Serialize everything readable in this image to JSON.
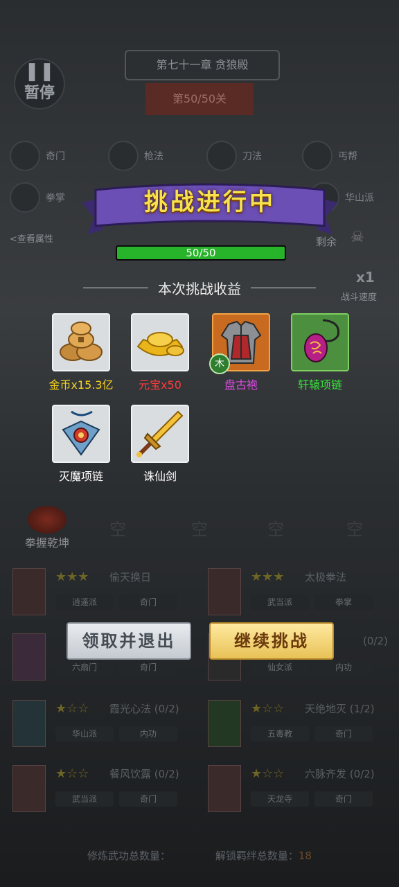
{
  "background": {
    "pause": {
      "icon": "pause-icon",
      "label": "暂停"
    },
    "chapter_title": "第七十一章 贪狼殿",
    "stage_label": "第50/50关",
    "skills_row1": [
      {
        "name": "奇门",
        "icon": "skill-icon"
      },
      {
        "name": "枪法",
        "icon": "skill-icon"
      },
      {
        "name": "刀法",
        "icon": "skill-icon"
      },
      {
        "name": "丐帮",
        "icon": "skill-icon"
      }
    ],
    "skills_row2": [
      {
        "name": "拳掌",
        "icon": "skill-icon"
      },
      {
        "name": "华山派",
        "icon": "skill-icon"
      }
    ],
    "view_attr_link": "<查看属性",
    "remaining_label": "剩余",
    "speed_multiplier": "x1",
    "speed_label": "战斗速度",
    "tab_main": "拳握乾坤",
    "tab_empty": "空",
    "cards": [
      {
        "name": "偷天换日",
        "tags": [
          "逍遥派",
          "奇门"
        ]
      },
      {
        "name": "太极拳法",
        "tags": [
          "武当派",
          "拳掌"
        ]
      },
      {
        "name": "",
        "tags": [
          "六扇门",
          "奇门"
        ]
      },
      {
        "name": "(0/2)",
        "tags": [
          "仙女派",
          "内功"
        ]
      },
      {
        "name": "霞光心法 (0/2)",
        "tags": [
          "华山派",
          "内功"
        ]
      },
      {
        "name": "天绝地灭 (1/2)",
        "tags": [
          "五毒教",
          "奇门"
        ]
      },
      {
        "name": "餐风饮露 (0/2)",
        "tags": [
          "武当派",
          "奇门"
        ]
      },
      {
        "name": "六脉齐发 (0/2)",
        "tags": [
          "天龙寺",
          "奇门"
        ]
      }
    ],
    "footer_a": "修炼武功总数量：",
    "footer_b": "解锁羁绊总数量：",
    "footer_b_value": "18"
  },
  "modal": {
    "banner_title": "挑战进行中",
    "progress": {
      "current": 50,
      "total": 50,
      "text": "50/50"
    },
    "rewards_heading": "本次挑战收益",
    "rewards": [
      {
        "name": "金币x15.3亿",
        "icon": "coins-icon",
        "quality": "white",
        "name_color": "#f4d21d"
      },
      {
        "name": "元宝x50",
        "icon": "gold-ingot-icon",
        "quality": "white",
        "name_color": "#ff3b3b"
      },
      {
        "name": "盘古袍",
        "icon": "armor-robe-icon",
        "quality": "orange",
        "name_color": "#e04be6",
        "element": "木"
      },
      {
        "name": "轩辕项链",
        "icon": "necklace-icon",
        "quality": "green",
        "name_color": "#39e23b"
      },
      {
        "name": "灭魔项链",
        "icon": "pendant-icon",
        "quality": "white",
        "name_color": "#ffffff"
      },
      {
        "name": "诛仙剑",
        "icon": "sword-icon",
        "quality": "white",
        "name_color": "#ffffff"
      }
    ],
    "buttons": {
      "exit": "领取并退出",
      "continue": "继续挑战"
    }
  }
}
